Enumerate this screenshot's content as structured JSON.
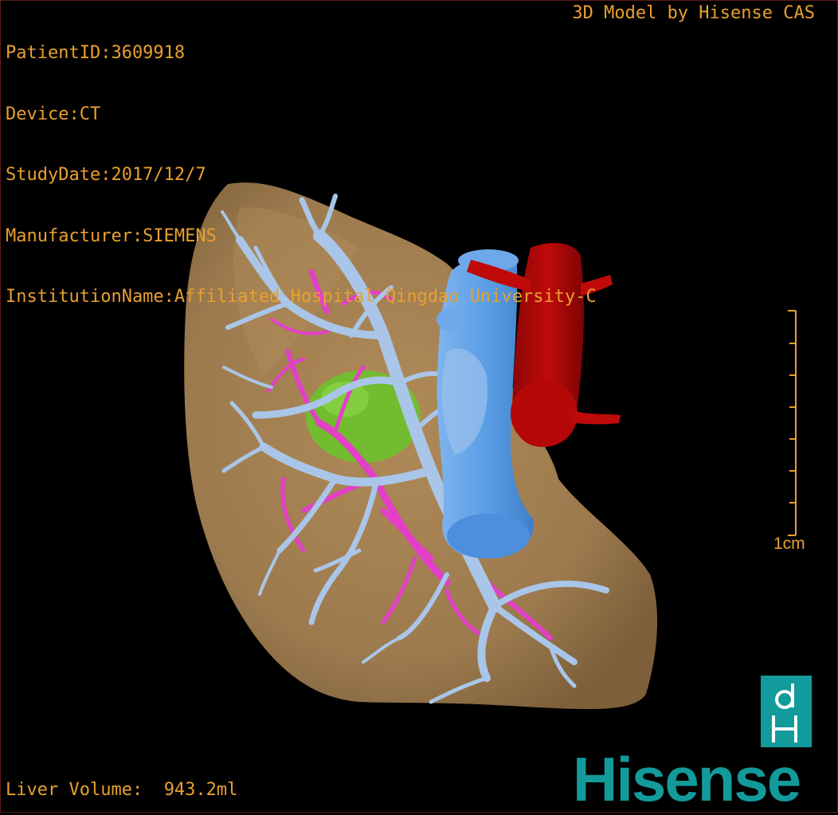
{
  "header": {
    "patient_id": "PatientID:3609918",
    "device": "Device:CT",
    "study_date": "StudyDate:2017/12/7",
    "manufacturer": "Manufacturer:SIEMENS",
    "institution": "InstitutionName:Affiliated Hospital Qingdao University-C"
  },
  "brand_title": "3D Model by Hisense CAS",
  "footer": {
    "volume_label": "Liver Volume:",
    "volume_value": "943.2ml"
  },
  "scale_bar": {
    "label": "1cm"
  },
  "logo": {
    "mark_icon": "dh-logo-icon",
    "wordmark": "Hisense"
  },
  "colors": {
    "overlay_text": "#e8a030",
    "liver": "#9c7a4e",
    "portal_vein": "#a9c6e8",
    "hepatic_artery": "#e43fc8",
    "vena_cava": "#5b9ee6",
    "aorta": "#c00a0a",
    "gallbladder": "#6cc22b",
    "brand": "#139a9a"
  }
}
